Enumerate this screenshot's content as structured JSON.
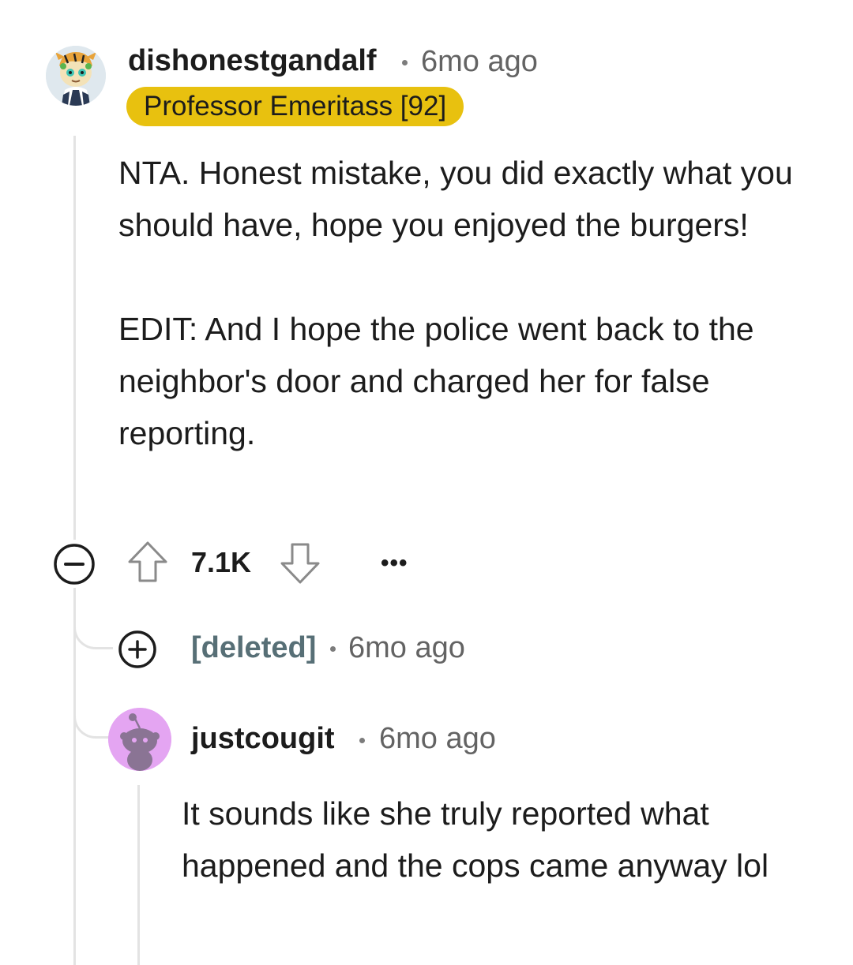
{
  "comments": [
    {
      "username": "dishonestgandalf",
      "timestamp": "6mo ago",
      "flair": "Professor Emeritass [92]",
      "flair_color": "#E8C10F",
      "avatar_icon": "tiger-avatar-icon",
      "body": [
        "NTA. Honest mistake, you did exactly what you should have, hope you enjoyed the burgers!",
        "EDIT: And I hope the police went back to the neighbor's door and charged her for false reporting."
      ],
      "collapse_icon": "minus-circle-icon",
      "upvote_icon": "arrow-up-icon",
      "vote_count": "7.1K",
      "downvote_icon": "arrow-down-icon",
      "more_label": "•••"
    },
    {
      "username": "[deleted]",
      "timestamp": "6mo ago",
      "expand_icon": "plus-circle-icon"
    },
    {
      "username": "justcougit",
      "timestamp": "6mo ago",
      "avatar_icon": "snoo-avatar-icon",
      "avatar_color": "#E4A5F2",
      "body": [
        "It sounds like she truly reported what happened and the cops came anyway lol"
      ]
    }
  ]
}
